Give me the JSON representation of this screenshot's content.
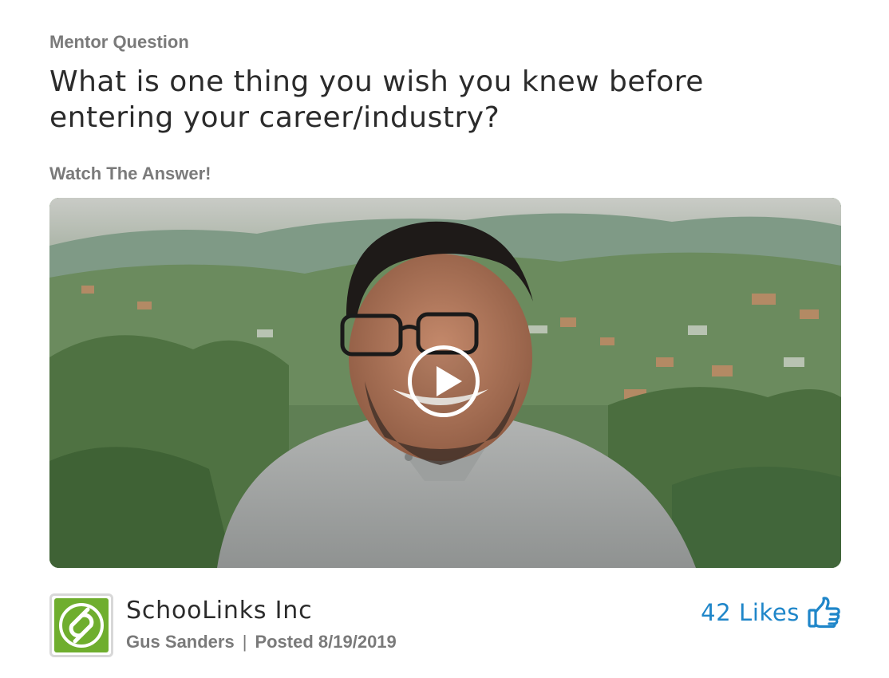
{
  "post": {
    "eyebrow": "Mentor Question",
    "question": "What is one thing you wish you knew before entering your career/industry?",
    "watch_label": "Watch The Answer!"
  },
  "video": {
    "play_icon": "play-icon",
    "thumbnail": "smiling man with glasses in grey polo shirt, green hills and village behind"
  },
  "author": {
    "organization": "SchooLinks Inc",
    "name": "Gus Sanders",
    "separator": "|",
    "posted": "Posted 8/19/2019",
    "logo_icon": "schoolinks-logo-icon"
  },
  "likes": {
    "label": "42 Likes",
    "icon": "thumbs-up-icon"
  },
  "colors": {
    "accent": "#1f86c9",
    "muted": "#7a7a7a",
    "text": "#2b2b2b",
    "logo_green": "#6fae2e"
  }
}
